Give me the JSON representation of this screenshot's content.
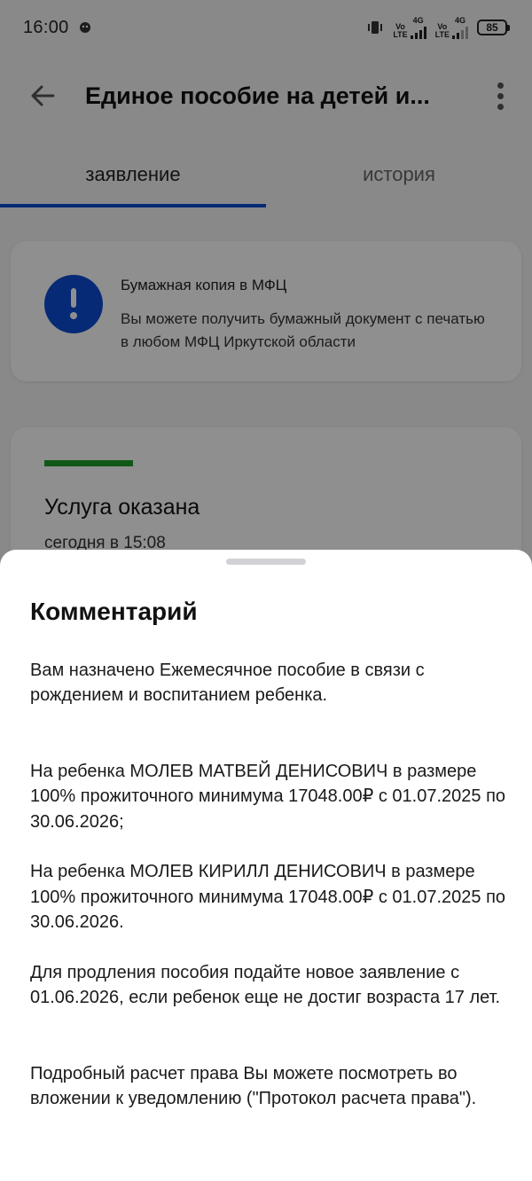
{
  "status_bar": {
    "time": "16:00",
    "network1_label_top": "Vo",
    "network1_label_bottom": "LTE",
    "network1_type": "4G",
    "network2_label_top": "Vo",
    "network2_label_bottom": "LTE",
    "network2_type": "4G",
    "battery": "85"
  },
  "header": {
    "title": "Единое пособие на детей и..."
  },
  "tabs": [
    {
      "label": "заявление",
      "active": true
    },
    {
      "label": "история",
      "active": false
    }
  ],
  "info_card": {
    "title": "Бумажная копия в МФЦ",
    "text": "Вы можете получить бумажный документ с печатью в любом МФЦ Иркутской области"
  },
  "status_card": {
    "title": "Услуга оказана",
    "time": "сегодня в 15:08"
  },
  "sheet": {
    "title": "Комментарий",
    "paragraphs": [
      "Вам назначено Ежемесячное пособие в связи с рождением и воспитанием ребенка.",
      "На ребенка МОЛЕВ МАТВЕЙ ДЕНИСОВИЧ в размере 100% прожиточного минимума 17048.00₽ с 01.07.2025 по 30.06.2026;",
      "На ребенка МОЛЕВ КИРИЛЛ ДЕНИСОВИЧ в размере 100% прожиточного минимума 17048.00₽ с 01.07.2025 по 30.06.2026.",
      "Для продления пособия подайте новое заявление с 01.06.2026, если ребенок еще не достиг возраста 17 лет.",
      "Подробный расчет права Вы можете посмотреть во вложении к уведомлению (\"Протокол расчета права\")."
    ]
  },
  "colors": {
    "accent": "#0d4cd3",
    "success": "#1e9e2a",
    "background": "#f4f4f6"
  }
}
